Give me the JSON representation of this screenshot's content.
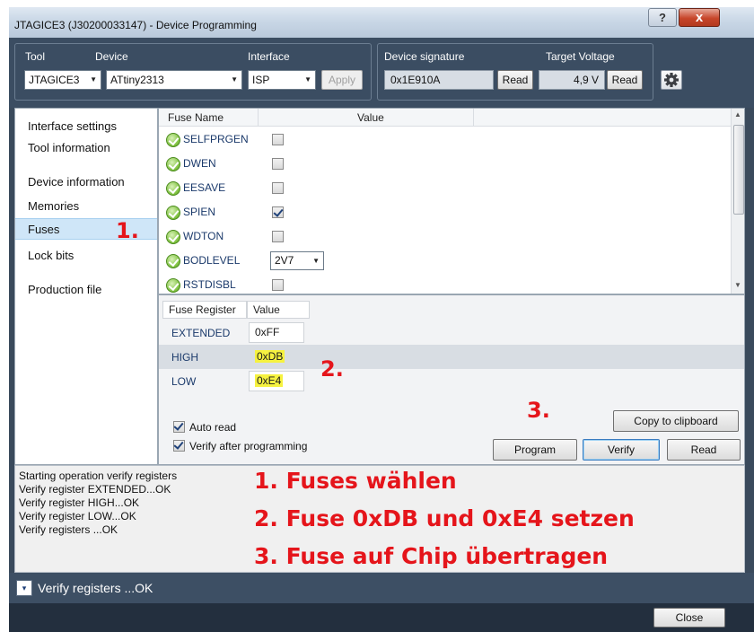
{
  "window": {
    "title": "JTAGICE3 (J30200033147) - Device Programming",
    "help_label": "?",
    "close_label": "x"
  },
  "toolbar": {
    "tool_label": "Tool",
    "tool_value": "JTAGICE3",
    "device_label": "Device",
    "device_value": "ATtiny2313",
    "interface_label": "Interface",
    "interface_value": "ISP",
    "apply_label": "Apply",
    "signature_label": "Device signature",
    "signature_value": "0x1E910A",
    "signature_read": "Read",
    "voltage_label": "Target Voltage",
    "voltage_value": "4,9 V",
    "voltage_read": "Read"
  },
  "sidebar": {
    "items": [
      {
        "label": "Interface settings"
      },
      {
        "label": "Tool information"
      },
      {
        "label": "Device information"
      },
      {
        "label": "Memories"
      },
      {
        "label": "Fuses",
        "selected": true
      },
      {
        "label": "Lock bits"
      },
      {
        "label": "Production file"
      }
    ]
  },
  "fuses": {
    "col_name": "Fuse Name",
    "col_value": "Value",
    "rows": [
      {
        "name": "SELFPRGEN",
        "checked": false
      },
      {
        "name": "DWEN",
        "checked": false
      },
      {
        "name": "EESAVE",
        "checked": false
      },
      {
        "name": "SPIEN",
        "checked": true
      },
      {
        "name": "WDTON",
        "checked": false
      },
      {
        "name": "BODLEVEL",
        "select": "2V7"
      },
      {
        "name": "RSTDISBL",
        "checked": false
      }
    ]
  },
  "registers": {
    "col_name": "Fuse Register",
    "col_value": "Value",
    "rows": [
      {
        "name": "EXTENDED",
        "value": "0xFF"
      },
      {
        "name": "HIGH",
        "value": "0xDB"
      },
      {
        "name": "LOW",
        "value": "0xE4"
      }
    ],
    "auto_read": "Auto read",
    "verify_after": "Verify after programming",
    "copy_label": "Copy to clipboard",
    "program_label": "Program",
    "verify_label": "Verify",
    "read_label": "Read"
  },
  "log": [
    "Starting operation verify registers",
    "Verify register EXTENDED...OK",
    "Verify register HIGH...OK",
    "Verify register LOW...OK",
    "Verify registers ...OK"
  ],
  "annotations": {
    "step1_marker": "1.",
    "step2_marker": "2.",
    "step3_marker": "3.",
    "line1": "1. Fuses wählen",
    "line2": "2. Fuse 0xDB und 0xE4 setzen",
    "line3": "3. Fuse auf Chip übertragen"
  },
  "status": {
    "text": "Verify registers ...OK",
    "expand_icon": "▾"
  },
  "footer": {
    "close_label": "Close"
  },
  "colors": {
    "annotation": "#e5151b",
    "highlight": "#f6f240",
    "selected": "#cfe6f8",
    "frame": "#3b4d62"
  }
}
